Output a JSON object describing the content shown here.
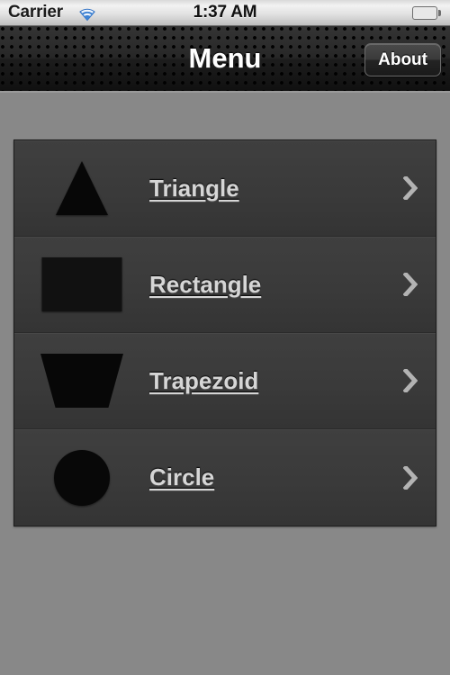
{
  "status_bar": {
    "carrier": "Carrier",
    "wifi_icon": "wifi-icon",
    "time": "1:37 AM",
    "battery_icon": "battery-full-icon"
  },
  "nav_bar": {
    "title": "Menu",
    "about_label": "About"
  },
  "menu": {
    "rows": [
      {
        "label": "Triangle",
        "shape": "triangle",
        "chevron": "chevron-right-icon"
      },
      {
        "label": "Rectangle",
        "shape": "rectangle",
        "chevron": "chevron-right-icon"
      },
      {
        "label": "Trapezoid",
        "shape": "trapezoid",
        "chevron": "chevron-right-icon"
      },
      {
        "label": "Circle",
        "shape": "circle",
        "chevron": "chevron-right-icon"
      }
    ]
  },
  "colors": {
    "page_background": "#888888",
    "table_background": "#3b3b3b",
    "nav_background": "#1b1b1b",
    "label_text": "#d6d6d6",
    "shape_fill": "#0a0a0a",
    "chevron": "#b0b0b0",
    "battery_green": "#7fc926",
    "wifi_blue": "#1f62b8"
  }
}
